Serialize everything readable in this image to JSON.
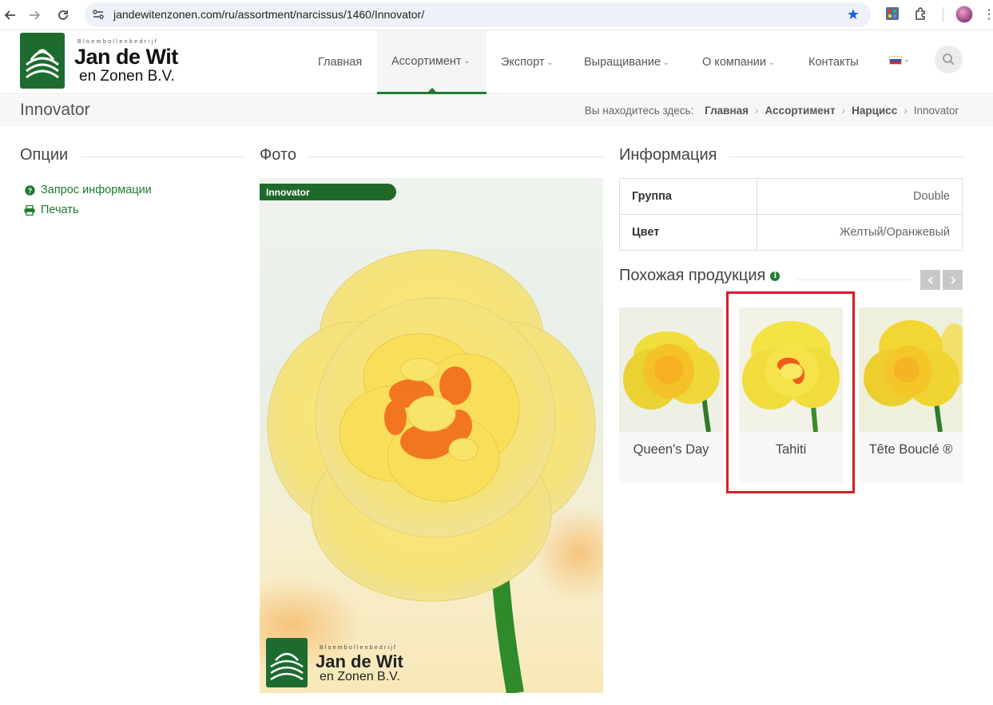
{
  "browser": {
    "url": "jandewitenzonen.com/ru/assortment/narcissus/1460/Innovator/",
    "back_icon": "arrow-left-icon",
    "forward_icon": "arrow-right-icon",
    "reload_icon": "reload-icon"
  },
  "logo": {
    "small_text": "Bloembollenbedrijf",
    "name": "Jan de Wit",
    "subname": "en Zonen B.V."
  },
  "menu": {
    "items": [
      {
        "label": "Главная"
      },
      {
        "label": "Ассортимент"
      },
      {
        "label": "Экспорт"
      },
      {
        "label": "Выращивание"
      },
      {
        "label": "О компании"
      },
      {
        "label": "Контакты"
      }
    ],
    "active": "Ассортимент"
  },
  "page": {
    "title": "Innovator",
    "breadcrumb_prefix": "Вы находитесь здесь:",
    "breadcrumbs": [
      "Главная",
      "Ассортимент",
      "Нарцисс",
      "Innovator"
    ]
  },
  "options": {
    "title": "Опции",
    "items": [
      {
        "label": "Запрос информации",
        "icon": "question-circle-icon"
      },
      {
        "label": "Печать",
        "icon": "print-icon"
      }
    ]
  },
  "photo": {
    "title": "Фото",
    "tag": "Innovator"
  },
  "info": {
    "title": "Информация",
    "rows": [
      {
        "key": "Группа",
        "value": "Double"
      },
      {
        "key": "Цвет",
        "value": "Желтый/Оранжевый"
      }
    ]
  },
  "similar": {
    "title": "Похожая продукция",
    "products": [
      {
        "name": "Queen's Day"
      },
      {
        "name": "Tahiti"
      },
      {
        "name": "Tête Bouclé ®"
      }
    ],
    "highlighted": "Tahiti"
  },
  "colors": {
    "brand_green": "#1d7a2e",
    "highlight_red": "#d4202a"
  }
}
